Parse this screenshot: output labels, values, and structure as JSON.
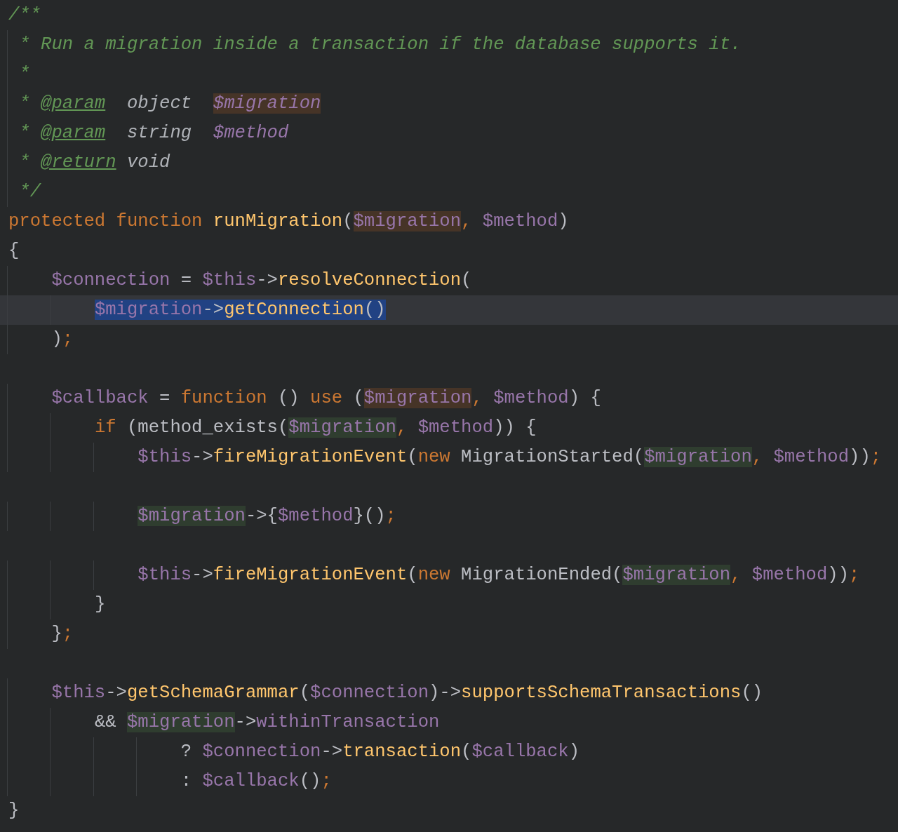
{
  "editor": {
    "lines": [
      {
        "current": false,
        "tokens": [
          {
            "kind": "comment",
            "text": "/**"
          }
        ]
      },
      {
        "current": false,
        "tokens": [
          {
            "kind": "comment",
            "text": " * Run a migration inside a transaction if the database supports it."
          }
        ]
      },
      {
        "current": false,
        "tokens": [
          {
            "kind": "comment",
            "text": " *"
          }
        ]
      },
      {
        "current": false,
        "tokens": [
          {
            "kind": "comment",
            "text": " * "
          },
          {
            "kind": "doctag",
            "text": "@param"
          },
          {
            "kind": "doctype",
            "text": "  object  "
          },
          {
            "kind": "docvar_write",
            "text": "$migration"
          }
        ]
      },
      {
        "current": false,
        "tokens": [
          {
            "kind": "comment",
            "text": " * "
          },
          {
            "kind": "doctag",
            "text": "@param"
          },
          {
            "kind": "doctype",
            "text": "  string  "
          },
          {
            "kind": "docvar",
            "text": "$method"
          }
        ]
      },
      {
        "current": false,
        "tokens": [
          {
            "kind": "comment",
            "text": " * "
          },
          {
            "kind": "doctag",
            "text": "@return"
          },
          {
            "kind": "doctype",
            "text": " void"
          }
        ]
      },
      {
        "current": false,
        "tokens": [
          {
            "kind": "comment",
            "text": " */"
          }
        ]
      },
      {
        "current": false,
        "tokens": [
          {
            "kind": "keyword",
            "text": "protected function "
          },
          {
            "kind": "func",
            "text": "runMigration"
          },
          {
            "kind": "plain",
            "text": "("
          },
          {
            "kind": "var_write",
            "text": "$migration"
          },
          {
            "kind": "punct",
            "text": ", "
          },
          {
            "kind": "var",
            "text": "$method"
          },
          {
            "kind": "plain",
            "text": ")"
          }
        ]
      },
      {
        "current": false,
        "tokens": [
          {
            "kind": "plain",
            "text": "{"
          }
        ]
      },
      {
        "current": false,
        "tokens": [
          {
            "kind": "var",
            "text": "    $connection"
          },
          {
            "kind": "plain",
            "text": " = "
          },
          {
            "kind": "var",
            "text": "$this"
          },
          {
            "kind": "plain",
            "text": "->"
          },
          {
            "kind": "func",
            "text": "resolveConnection"
          },
          {
            "kind": "plain",
            "text": "("
          }
        ]
      },
      {
        "current": true,
        "tokens": [
          {
            "kind": "sel_var",
            "text": "        $migration"
          },
          {
            "kind": "sel_plain",
            "text": "->"
          },
          {
            "kind": "sel_func",
            "text": "getConnection"
          },
          {
            "kind": "sel_plain",
            "text": "()"
          }
        ]
      },
      {
        "current": false,
        "tokens": [
          {
            "kind": "plain",
            "text": "    )"
          },
          {
            "kind": "punct",
            "text": ";"
          }
        ]
      },
      {
        "current": false
      },
      {
        "current": false,
        "tokens": [
          {
            "kind": "var",
            "text": "    $callback"
          },
          {
            "kind": "plain",
            "text": " = "
          },
          {
            "kind": "keyword",
            "text": "function "
          },
          {
            "kind": "plain",
            "text": "() "
          },
          {
            "kind": "keyword",
            "text": "use "
          },
          {
            "kind": "plain",
            "text": "("
          },
          {
            "kind": "var_write",
            "text": "$migration"
          },
          {
            "kind": "punct",
            "text": ", "
          },
          {
            "kind": "var",
            "text": "$method"
          },
          {
            "kind": "plain",
            "text": ") {"
          }
        ]
      },
      {
        "current": false,
        "tokens": [
          {
            "kind": "keyword",
            "text": "        if "
          },
          {
            "kind": "plain",
            "text": "(method_exists("
          },
          {
            "kind": "var_read",
            "text": "$migration"
          },
          {
            "kind": "punct",
            "text": ", "
          },
          {
            "kind": "var",
            "text": "$method"
          },
          {
            "kind": "plain",
            "text": ")) {"
          }
        ]
      },
      {
        "current": false,
        "tokens": [
          {
            "kind": "var",
            "text": "            $this"
          },
          {
            "kind": "plain",
            "text": "->"
          },
          {
            "kind": "func",
            "text": "fireMigrationEvent"
          },
          {
            "kind": "plain",
            "text": "("
          },
          {
            "kind": "keyword",
            "text": "new "
          },
          {
            "kind": "plain",
            "text": "MigrationStarted("
          },
          {
            "kind": "var_read",
            "text": "$migration"
          },
          {
            "kind": "punct",
            "text": ", "
          },
          {
            "kind": "var",
            "text": "$method"
          },
          {
            "kind": "plain",
            "text": "))"
          },
          {
            "kind": "punct",
            "text": ";"
          }
        ]
      },
      {
        "current": false
      },
      {
        "current": false,
        "tokens": [
          {
            "kind": "var_read",
            "text": "            $migration"
          },
          {
            "kind": "plain",
            "text": "->{"
          },
          {
            "kind": "var",
            "text": "$method"
          },
          {
            "kind": "plain",
            "text": "}()"
          },
          {
            "kind": "punct",
            "text": ";"
          }
        ]
      },
      {
        "current": false
      },
      {
        "current": false,
        "tokens": [
          {
            "kind": "var",
            "text": "            $this"
          },
          {
            "kind": "plain",
            "text": "->"
          },
          {
            "kind": "func",
            "text": "fireMigrationEvent"
          },
          {
            "kind": "plain",
            "text": "("
          },
          {
            "kind": "keyword",
            "text": "new "
          },
          {
            "kind": "plain",
            "text": "MigrationEnded("
          },
          {
            "kind": "var_read",
            "text": "$migration"
          },
          {
            "kind": "punct",
            "text": ", "
          },
          {
            "kind": "var",
            "text": "$method"
          },
          {
            "kind": "plain",
            "text": "))"
          },
          {
            "kind": "punct",
            "text": ";"
          }
        ]
      },
      {
        "current": false,
        "tokens": [
          {
            "kind": "plain",
            "text": "        }"
          }
        ]
      },
      {
        "current": false,
        "tokens": [
          {
            "kind": "plain",
            "text": "    }"
          },
          {
            "kind": "punct",
            "text": ";"
          }
        ]
      },
      {
        "current": false
      },
      {
        "current": false,
        "tokens": [
          {
            "kind": "var",
            "text": "    $this"
          },
          {
            "kind": "plain",
            "text": "->"
          },
          {
            "kind": "func",
            "text": "getSchemaGrammar"
          },
          {
            "kind": "plain",
            "text": "("
          },
          {
            "kind": "var",
            "text": "$connection"
          },
          {
            "kind": "plain",
            "text": ")->"
          },
          {
            "kind": "func",
            "text": "supportsSchemaTransactions"
          },
          {
            "kind": "plain",
            "text": "()"
          }
        ]
      },
      {
        "current": false,
        "tokens": [
          {
            "kind": "plain",
            "text": "        && "
          },
          {
            "kind": "var_read",
            "text": "$migration"
          },
          {
            "kind": "plain",
            "text": "->"
          },
          {
            "kind": "var",
            "text": "withinTransaction"
          }
        ]
      },
      {
        "current": false,
        "tokens": [
          {
            "kind": "plain",
            "text": "                ? "
          },
          {
            "kind": "var",
            "text": "$connection"
          },
          {
            "kind": "plain",
            "text": "->"
          },
          {
            "kind": "func",
            "text": "transaction"
          },
          {
            "kind": "plain",
            "text": "("
          },
          {
            "kind": "var",
            "text": "$callback"
          },
          {
            "kind": "plain",
            "text": ")"
          }
        ]
      },
      {
        "current": false,
        "tokens": [
          {
            "kind": "plain",
            "text": "                : "
          },
          {
            "kind": "var",
            "text": "$callback"
          },
          {
            "kind": "plain",
            "text": "()"
          },
          {
            "kind": "punct",
            "text": ";"
          }
        ]
      },
      {
        "current": false,
        "tokens": [
          {
            "kind": "plain",
            "text": "}"
          }
        ]
      }
    ]
  }
}
